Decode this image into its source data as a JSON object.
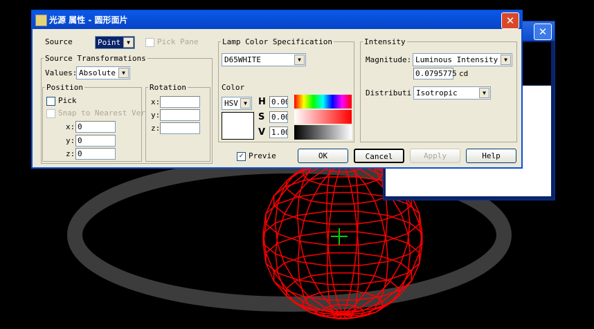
{
  "dialog": {
    "title": "光源 属性 - 圆形面片",
    "close_icon": "close-icon"
  },
  "source": {
    "label": "Source",
    "value": "Point",
    "pick_pane": "Pick Pane"
  },
  "transform": {
    "legend": "Source Transformations",
    "values_label": "Values:",
    "values_value": "Absolute",
    "position": {
      "legend": "Position",
      "pick": "Pick",
      "snap": "Snap to Nearest Ver",
      "x_label": "x:",
      "y_label": "y:",
      "z_label": "z:",
      "x": "0",
      "y": "0",
      "z": "0"
    },
    "rotation": {
      "legend": "Rotation",
      "x_label": "x:",
      "y_label": "y:",
      "z_label": "z:",
      "x": "",
      "y": "",
      "z": ""
    }
  },
  "lamp": {
    "legend": "Lamp Color Specification",
    "preset": "D65WHITE",
    "color_label": "Color",
    "model": "HSV",
    "h_label": "H",
    "s_label": "S",
    "v_label": "V",
    "h": "0.00",
    "s": "0.00",
    "v": "1.00",
    "swatch": "#ffffff"
  },
  "intensity": {
    "legend": "Intensity",
    "magnitude_label": "Magnitude:",
    "magnitude_value": "Luminous Intensity",
    "amount": "0.0795775",
    "unit": "cd",
    "distribution_label": "Distributi",
    "distribution_value": "Isotropic"
  },
  "footer": {
    "preview": "Preview",
    "preview_checked": true,
    "ok": "OK",
    "cancel": "Cancel",
    "apply": "Apply",
    "help": "Help"
  },
  "scene": {
    "wire_color": "#ff0000",
    "ring_color": "#3c3c3c"
  }
}
